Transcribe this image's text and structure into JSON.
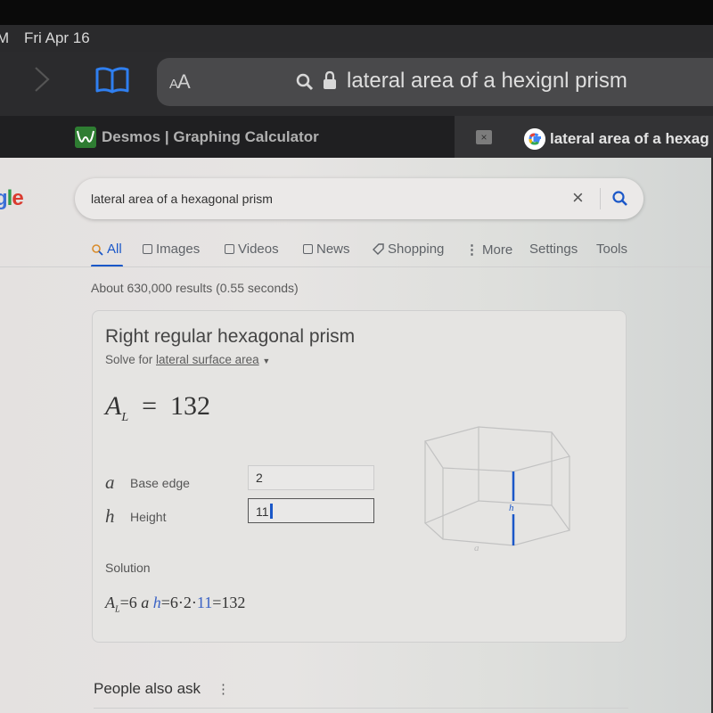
{
  "status_bar": {
    "time_fragment": "M",
    "date": "Fri Apr 16"
  },
  "toolbar": {
    "text_size_label_small": "A",
    "text_size_label_large": "A",
    "url": "lateral area of a hexignl prism"
  },
  "tabs": [
    {
      "title": "Desmos | Graphing Calculator",
      "active": false
    },
    {
      "title": "lateral area of a hexag",
      "active": true
    }
  ],
  "tab_close_label": "×",
  "google": {
    "logo_letters": [
      {
        "ch": "g",
        "color": "#3b6fd6"
      },
      {
        "ch": "l",
        "color": "#2d9a4b"
      },
      {
        "ch": "e",
        "color": "#d93a2f"
      }
    ],
    "search_query": "lateral area of a hexagonal prism",
    "clear_label": "×",
    "nav": {
      "items": [
        {
          "label": "All",
          "icon": "search-icon",
          "active": true
        },
        {
          "label": "Images",
          "icon": "image-icon"
        },
        {
          "label": "Videos",
          "icon": "video-icon"
        },
        {
          "label": "News",
          "icon": "news-icon"
        },
        {
          "label": "Shopping",
          "icon": "tag-icon"
        },
        {
          "label": "More",
          "icon": "more-vert-icon"
        }
      ],
      "settings": "Settings",
      "tools": "Tools"
    },
    "result_stats": "About 630,000 results (0.55 seconds)"
  },
  "calculator": {
    "title": "Right regular hexagonal prism",
    "solve_for_prefix": "Solve for",
    "solve_for_target": "lateral surface area",
    "result_symbol": "A",
    "result_subscript": "L",
    "result_equals": "=",
    "result_value": "132",
    "variables": [
      {
        "symbol": "a",
        "label": "Base edge",
        "value": "2",
        "focused": false
      },
      {
        "symbol": "h",
        "label": "Height",
        "value": "11",
        "focused": true
      }
    ],
    "solution_label": "Solution",
    "formula": {
      "lhs": "A",
      "lhs_sub": "L",
      "expr1": "=6",
      "a": "a",
      "h": "h",
      "expr2": "=6·2·",
      "h_val": "11",
      "expr3": "=132"
    },
    "diagram_labels": {
      "height": "h",
      "edge": "a"
    }
  },
  "people_also_ask": {
    "label": "People also ask",
    "menu_icon": "⋮"
  },
  "colors": {
    "accent_blue": "#1a57c8",
    "formula_blue": "#3a62c4",
    "desmos_green": "#2e7d32"
  }
}
